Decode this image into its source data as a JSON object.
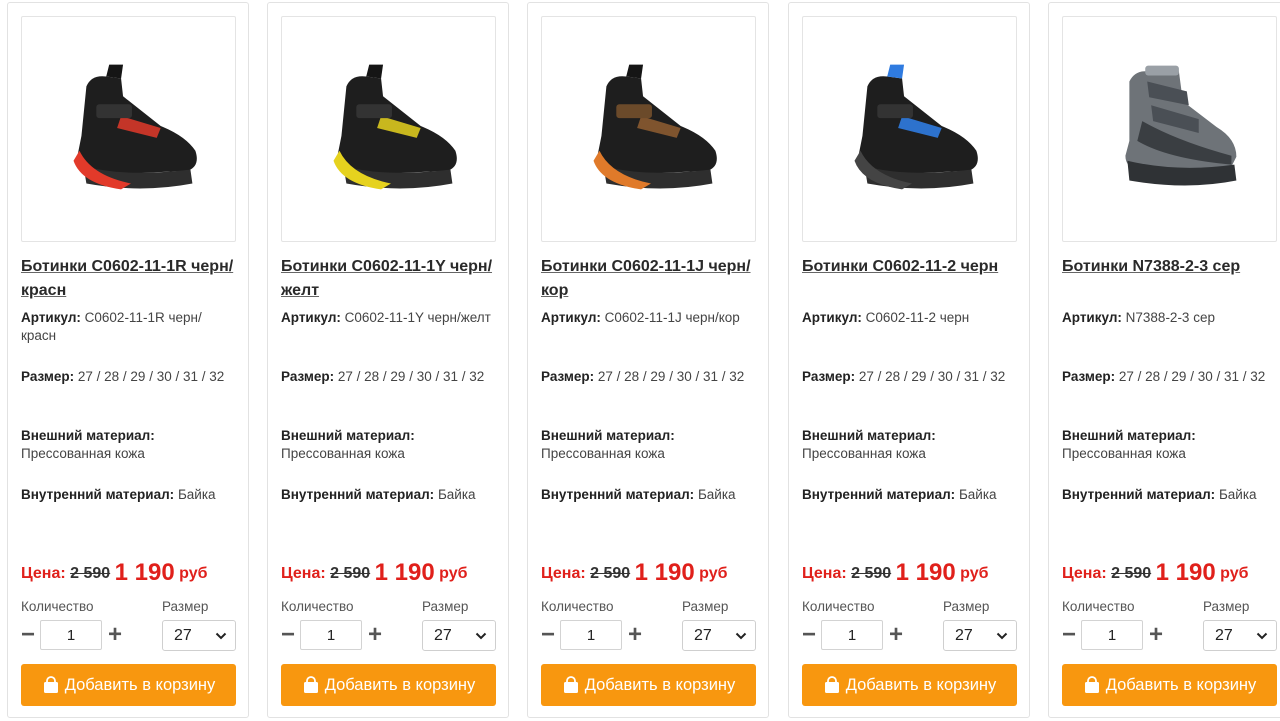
{
  "common": {
    "article_label": "Артикул:",
    "size_attr_label": "Размер:",
    "outer_label": "Внешний материал:",
    "inner_label": "Внутренний материал:",
    "price_label": "Цена:",
    "currency": "руб",
    "qty_label": "Количество",
    "size_label": "Размер",
    "add_to_cart": "Добавить в корзину",
    "minus": "−",
    "plus": "+"
  },
  "products": [
    {
      "title": "Ботинки C0602-11-1R черн/красн",
      "article": "C0602-11-1R черн/красн",
      "sizes": "27 / 28 / 29 / 30 / 31 / 32",
      "outer": "Прессованная кожа",
      "inner": "Байка",
      "old_price": "2 590",
      "price": "1 190",
      "qty": "1",
      "size": "27",
      "accent": "#e23a2a"
    },
    {
      "title": "Ботинки C0602-11-1Y черн/желт",
      "article": "C0602-11-1Y черн/желт",
      "sizes": "27 / 28 / 29 / 30 / 31 / 32",
      "outer": "Прессованная кожа",
      "inner": "Байка",
      "old_price": "2 590",
      "price": "1 190",
      "qty": "1",
      "size": "27",
      "accent": "#e6d21e"
    },
    {
      "title": "Ботинки C0602-11-1J черн/кор",
      "article": "C0602-11-1J черн/кор",
      "sizes": "27 / 28 / 29 / 30 / 31 / 32",
      "outer": "Прессованная кожа",
      "inner": "Байка",
      "old_price": "2 590",
      "price": "1 190",
      "qty": "1",
      "size": "27",
      "accent": "#e07a2a"
    },
    {
      "title": "Ботинки C0602-11-2 черн",
      "article": "C0602-11-2 черн",
      "sizes": "27 / 28 / 29 / 30 / 31 / 32",
      "outer": "Прессованная кожа",
      "inner": "Байка",
      "old_price": "2 590",
      "price": "1 190",
      "qty": "1",
      "size": "27",
      "accent": "#2f7be0"
    },
    {
      "title": "Ботинки N7388-2-3 сер",
      "article": "N7388-2-3 сер",
      "sizes": "27 / 28 / 29 / 30 / 31 / 32",
      "outer": "Прессованная кожа",
      "inner": "Байка",
      "old_price": "2 590",
      "price": "1 190",
      "qty": "1",
      "size": "27",
      "accent": "#7b8088"
    }
  ],
  "colors": {
    "price_red": "#e0201b",
    "button_orange": "#f8970f"
  }
}
